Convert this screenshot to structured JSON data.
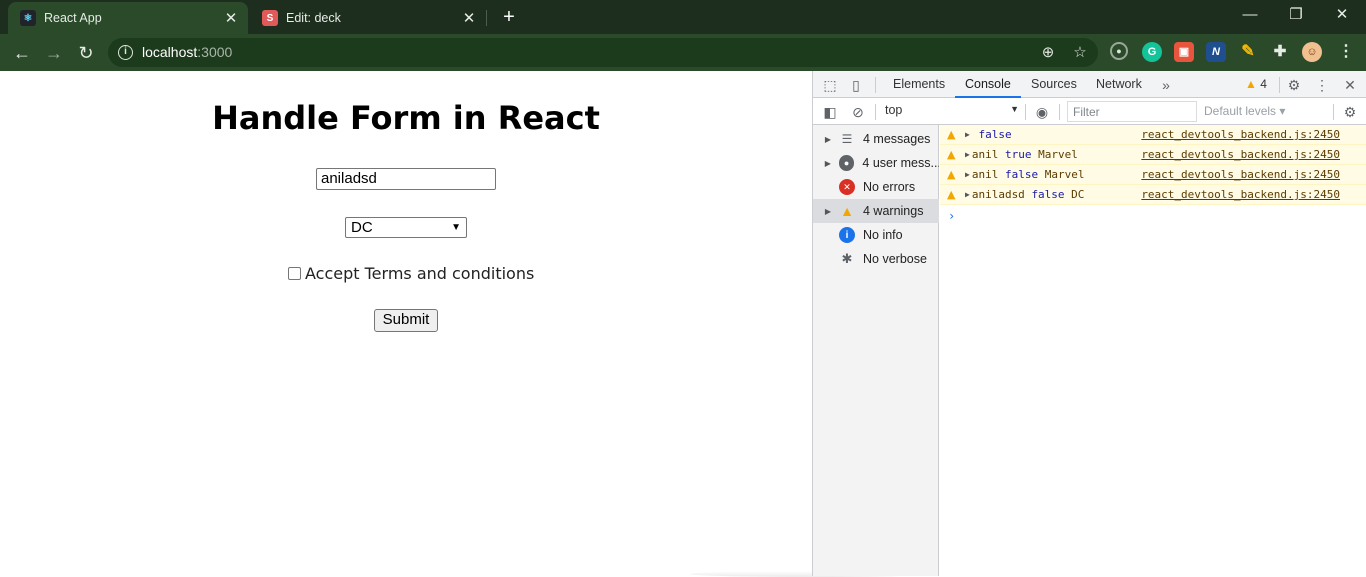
{
  "browser": {
    "tabs": [
      {
        "title": "React App",
        "favicon": "react-favicon",
        "active": true
      },
      {
        "title": "Edit: deck",
        "favicon": "deck-favicon",
        "favicon_letter": "S",
        "active": false
      }
    ],
    "url_host": "localhost",
    "url_port": ":3000",
    "extensions": [
      "zoom-icon",
      "bookmark-star-icon",
      "circle-ext-icon",
      "grammarly-icon",
      "screenshot-ext-icon",
      "n-ext-icon",
      "pen-ext-icon",
      "puzzle-icon",
      "profile-avatar"
    ]
  },
  "page": {
    "heading": "Handle Form in React",
    "name_value": "aniladsd",
    "select_value": "DC",
    "checkbox_label": "Accept Terms and conditions",
    "submit_label": "Submit"
  },
  "devtools": {
    "tabs": [
      "Elements",
      "Console",
      "Sources",
      "Network"
    ],
    "active_tab": "Console",
    "warning_count": "4",
    "context": "top",
    "filter_placeholder": "Filter",
    "levels_label": "Default levels",
    "sidebar": [
      {
        "label": "4 messages",
        "icon": "list-icon",
        "expandable": true
      },
      {
        "label": "4 user mess...",
        "icon": "user-icon",
        "expandable": true
      },
      {
        "label": "No errors",
        "icon": "error-icon",
        "expandable": false
      },
      {
        "label": "4 warnings",
        "icon": "warning-icon",
        "expandable": true,
        "selected": true
      },
      {
        "label": "No info",
        "icon": "info-icon",
        "expandable": false
      },
      {
        "label": "No verbose",
        "icon": "bug-icon",
        "expandable": false
      }
    ],
    "messages": [
      {
        "text": " false",
        "parts": [
          {
            "t": "",
            "kw": false
          },
          {
            "t": "false",
            "kw": true
          }
        ],
        "source": "react_devtools_backend.js:2450"
      },
      {
        "text": "anil true Marvel",
        "parts": [
          {
            "t": "anil ",
            "kw": false
          },
          {
            "t": "true",
            "kw": true
          },
          {
            "t": " Marvel",
            "kw": false
          }
        ],
        "source": "react_devtools_backend.js:2450"
      },
      {
        "text": "anil false Marvel",
        "parts": [
          {
            "t": "anil ",
            "kw": false
          },
          {
            "t": "false",
            "kw": true
          },
          {
            "t": " Marvel",
            "kw": false
          }
        ],
        "source": "react_devtools_backend.js:2450"
      },
      {
        "text": "aniladsd false DC",
        "parts": [
          {
            "t": "aniladsd ",
            "kw": false
          },
          {
            "t": "false",
            "kw": true
          },
          {
            "t": " DC",
            "kw": false
          }
        ],
        "source": "react_devtools_backend.js:2450"
      }
    ]
  }
}
